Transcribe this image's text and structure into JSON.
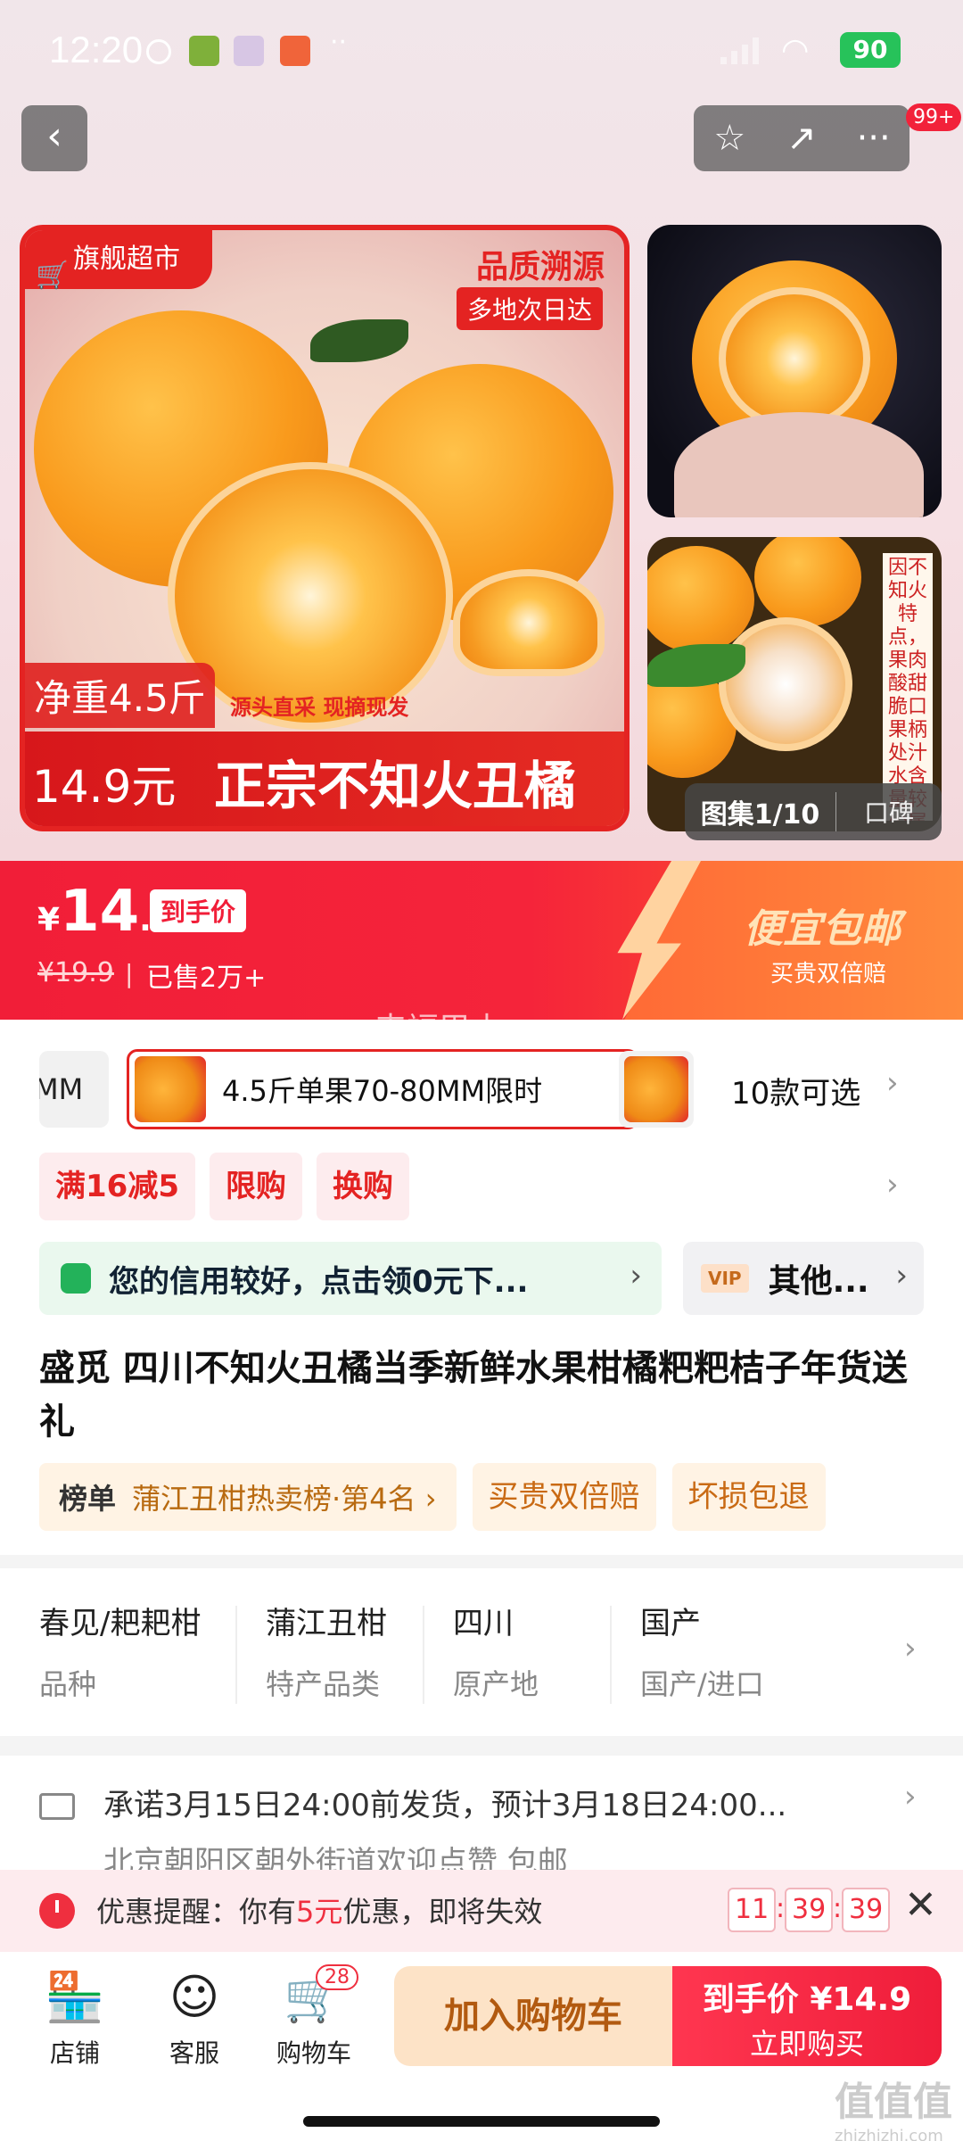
{
  "status_bar": {
    "time": "12:20",
    "battery": "90"
  },
  "nav": {
    "back_glyph": "‹",
    "star_glyph": "☆",
    "share_glyph": "↗",
    "more_glyph": "···",
    "badge": "99+"
  },
  "hero": {
    "flagship": "旗舰超市",
    "quality": "品质溯源",
    "nextday": "多地次日达",
    "weight": "净重4.5斤",
    "sub": "源头直采 现摘现发",
    "price": "14.9元",
    "title": "正宗不知火丑橘",
    "side_note": "因不知火特点，果肉酸甜脆口果柄处汁水含量较少属正常现象",
    "gallery": "图集1/10",
    "reviews": "口碑"
  },
  "price": {
    "yen": "¥",
    "int": "14",
    "dec": ".9",
    "tag": "到手价",
    "old": "¥19.9",
    "sep": "|",
    "sold": "已售2万+",
    "promo_title": "便宜包邮",
    "promo_sub": "买贵双倍赔",
    "watermark": "来福巴士"
  },
  "sku": {
    "left": "MM",
    "selected": "4.5斤单果70-80MM限时",
    "count": "10款可选",
    "chevron": "›"
  },
  "promos": [
    "满16减5",
    "限购",
    "换购"
  ],
  "credit": {
    "text": "您的信用较好，点击领0元下...",
    "vip_badge": "VIP",
    "vip_text": "其他..."
  },
  "title": "盛觅 四川不知火丑橘当季新鲜水果柑橘粑粑桔子年货送礼",
  "tags": {
    "rank_label": "榜单",
    "rank_text": "蒲江丑柑热卖榜·第4名 ›",
    "tag1": "买贵双倍赔",
    "tag2": "坏损包退"
  },
  "attrs": [
    {
      "value": "春见/耙耙柑",
      "key": "品种"
    },
    {
      "value": "蒲江丑柑",
      "key": "特产品类"
    },
    {
      "value": "四川",
      "key": "原产地"
    },
    {
      "value": "国产",
      "key": "国产/进口"
    }
  ],
  "shipping": {
    "line1": "承诺3月15日24:00前发货，预计3月18日24:00...",
    "line2": "北京朝阳区朝外街道欢迎点赞  包邮"
  },
  "alert": {
    "prefix": "优惠提醒：你有",
    "amount": "5元",
    "suffix": "优惠，即将失效",
    "h": "11",
    "m": "39",
    "s": "39",
    "close": "✕"
  },
  "bottom": {
    "shop": "店铺",
    "service": "客服",
    "cart": "购物车",
    "cart_count": "28",
    "add_cart": "加入购物车",
    "buy_price": "到手价 ¥14.9",
    "buy_now": "立即购买"
  },
  "site_mark": {
    "name": "值值值",
    "url": "zhizhizhi.com"
  }
}
